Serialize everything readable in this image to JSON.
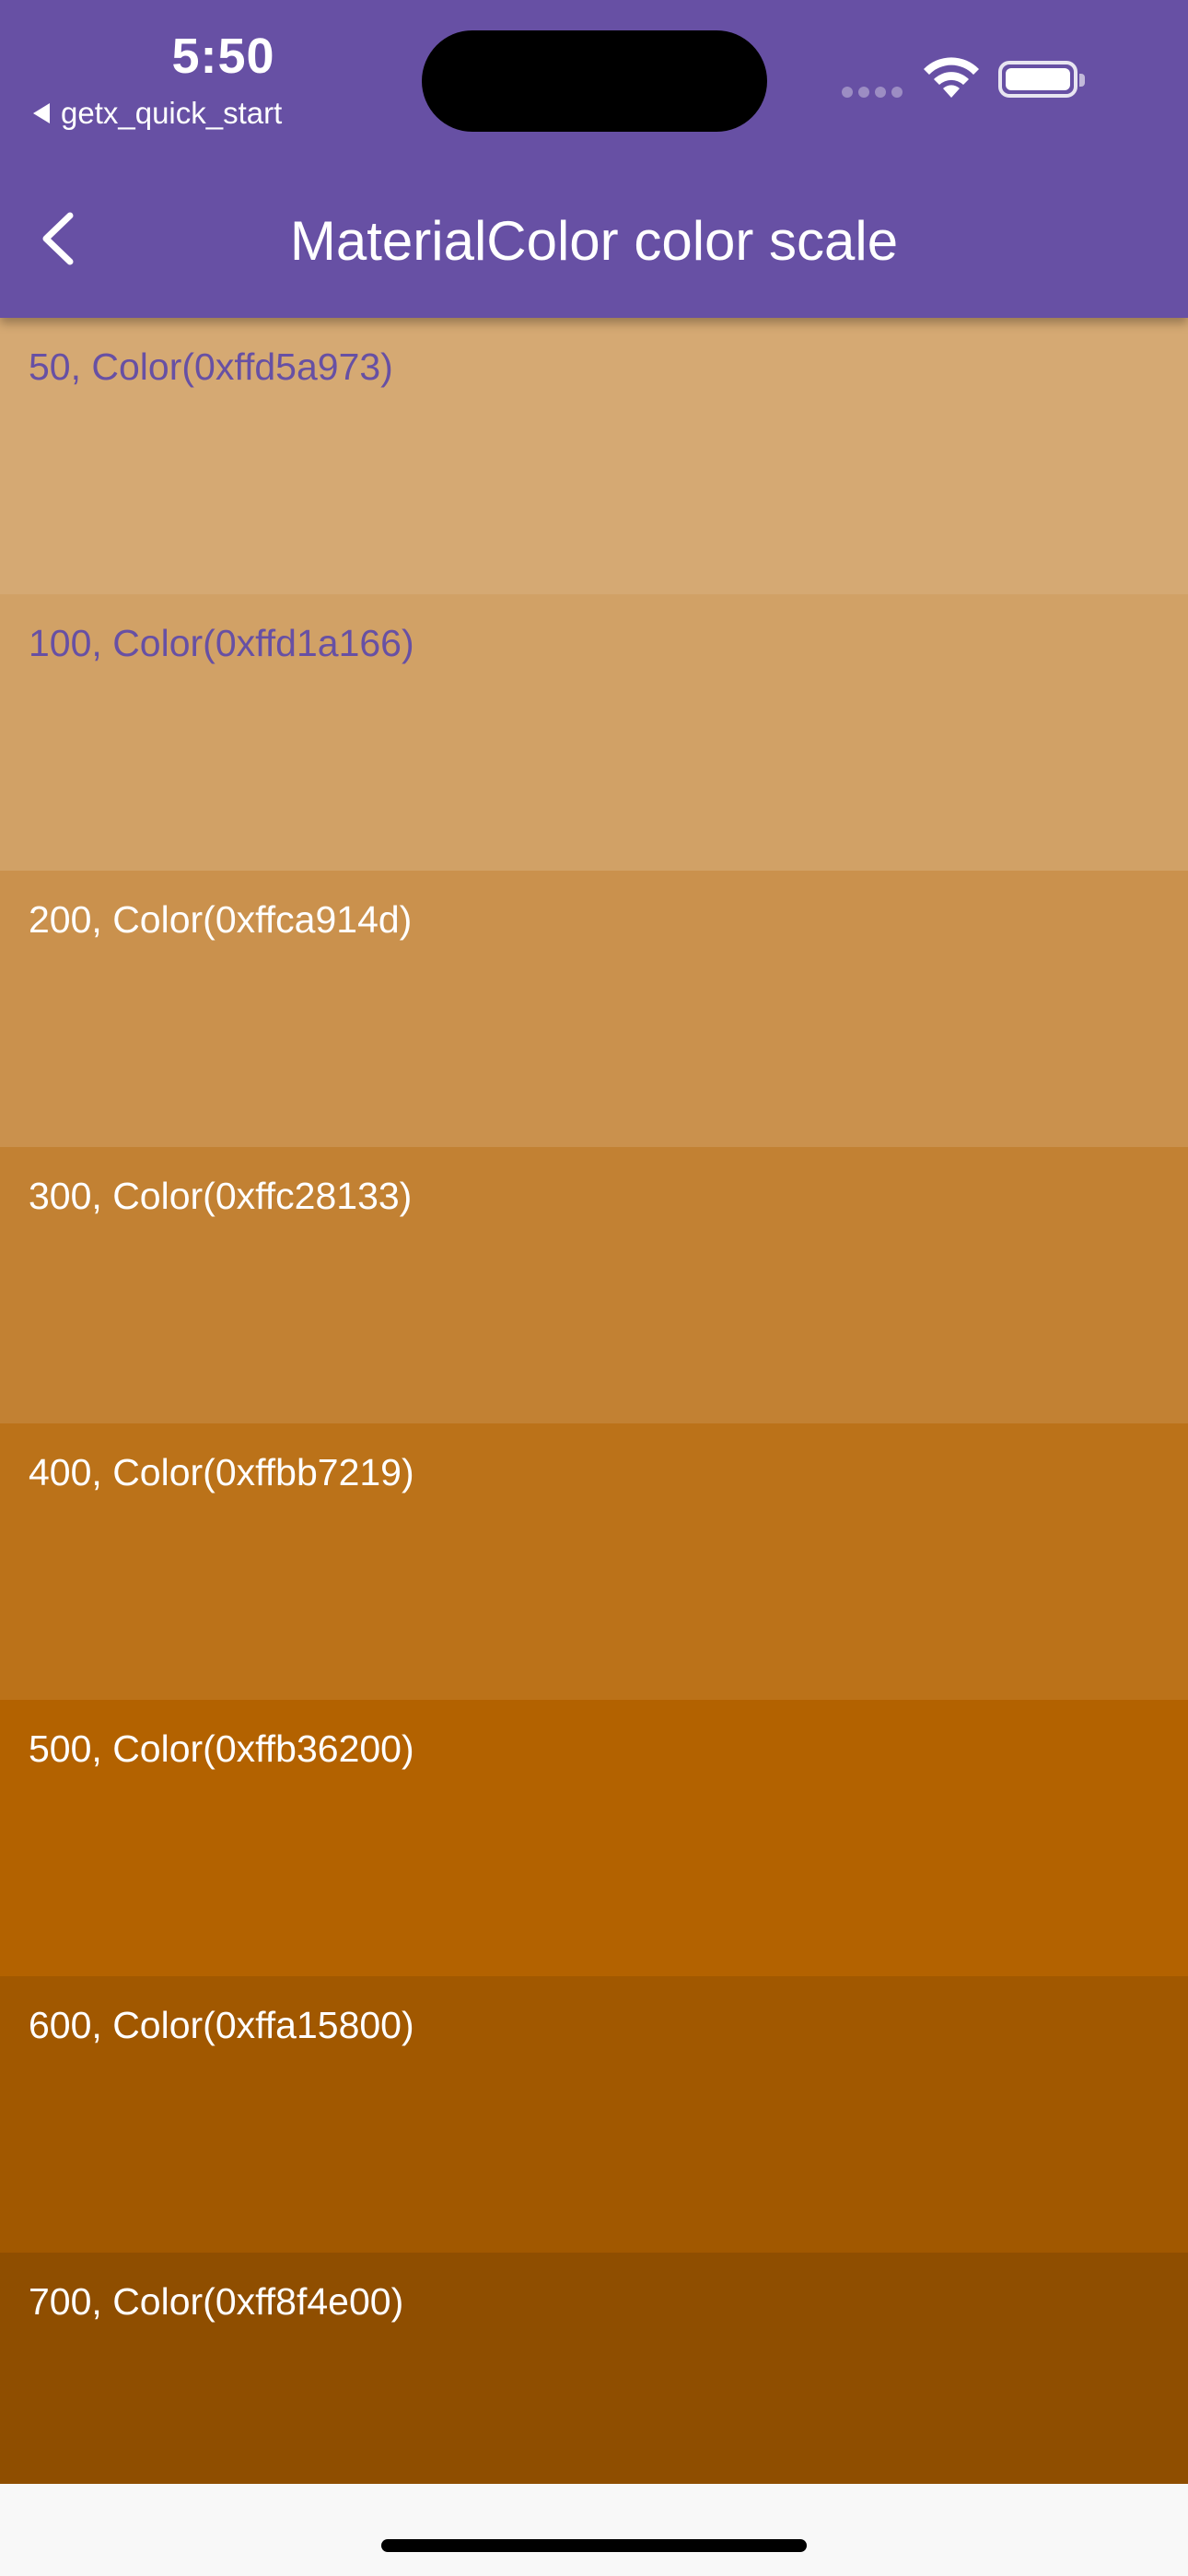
{
  "status": {
    "time": "5:50",
    "back_app": "getx_quick_start"
  },
  "appbar": {
    "title": "MaterialColor color scale",
    "color": "#6750a4",
    "back_icon": "chevron-left-icon"
  },
  "swatches": [
    {
      "label": "50, Color(0xffd5a973)",
      "color": "#d5a973",
      "text_color": "#6750a4"
    },
    {
      "label": "100, Color(0xffd1a166)",
      "color": "#d1a166",
      "text_color": "#6750a4"
    },
    {
      "label": "200, Color(0xffca914d)",
      "color": "#ca914d",
      "text_color": "#ffffff"
    },
    {
      "label": "300, Color(0xffc28133)",
      "color": "#c28133",
      "text_color": "#ffffff"
    },
    {
      "label": "400, Color(0xffbb7219)",
      "color": "#bb7219",
      "text_color": "#ffffff"
    },
    {
      "label": "500, Color(0xffb36200)",
      "color": "#b36200",
      "text_color": "#ffffff"
    },
    {
      "label": "600, Color(0xffa15800)",
      "color": "#a15800",
      "text_color": "#ffffff"
    },
    {
      "label": "700, Color(0xff8f4e00)",
      "color": "#8f4e00",
      "text_color": "#ffffff"
    }
  ]
}
